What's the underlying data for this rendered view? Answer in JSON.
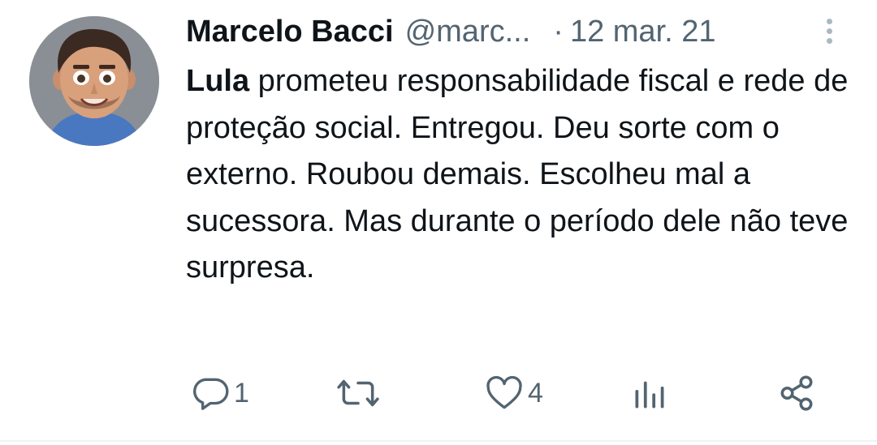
{
  "tweet": {
    "author_name": "Marcelo Bacci",
    "author_handle": "@marc...",
    "separator": "·",
    "date": "12 mar. 21",
    "mention": "Lula",
    "body": " prometeu responsabilidade fiscal e rede de proteção social. Entregou. Deu sorte com o externo. Roubou demais. Escolheu mal a sucessora. Mas durante o período dele não teve surpresa."
  },
  "actions": {
    "reply_count": "1",
    "retweet_count": "",
    "like_count": "4",
    "views_count": ""
  },
  "icons": [
    "avatar",
    "more-options-icon",
    "reply-icon",
    "retweet-icon",
    "like-icon",
    "views-icon",
    "share-icon"
  ],
  "colors": {
    "text": "#0f1419",
    "secondary_text": "#536471",
    "background": "#ffffff"
  }
}
